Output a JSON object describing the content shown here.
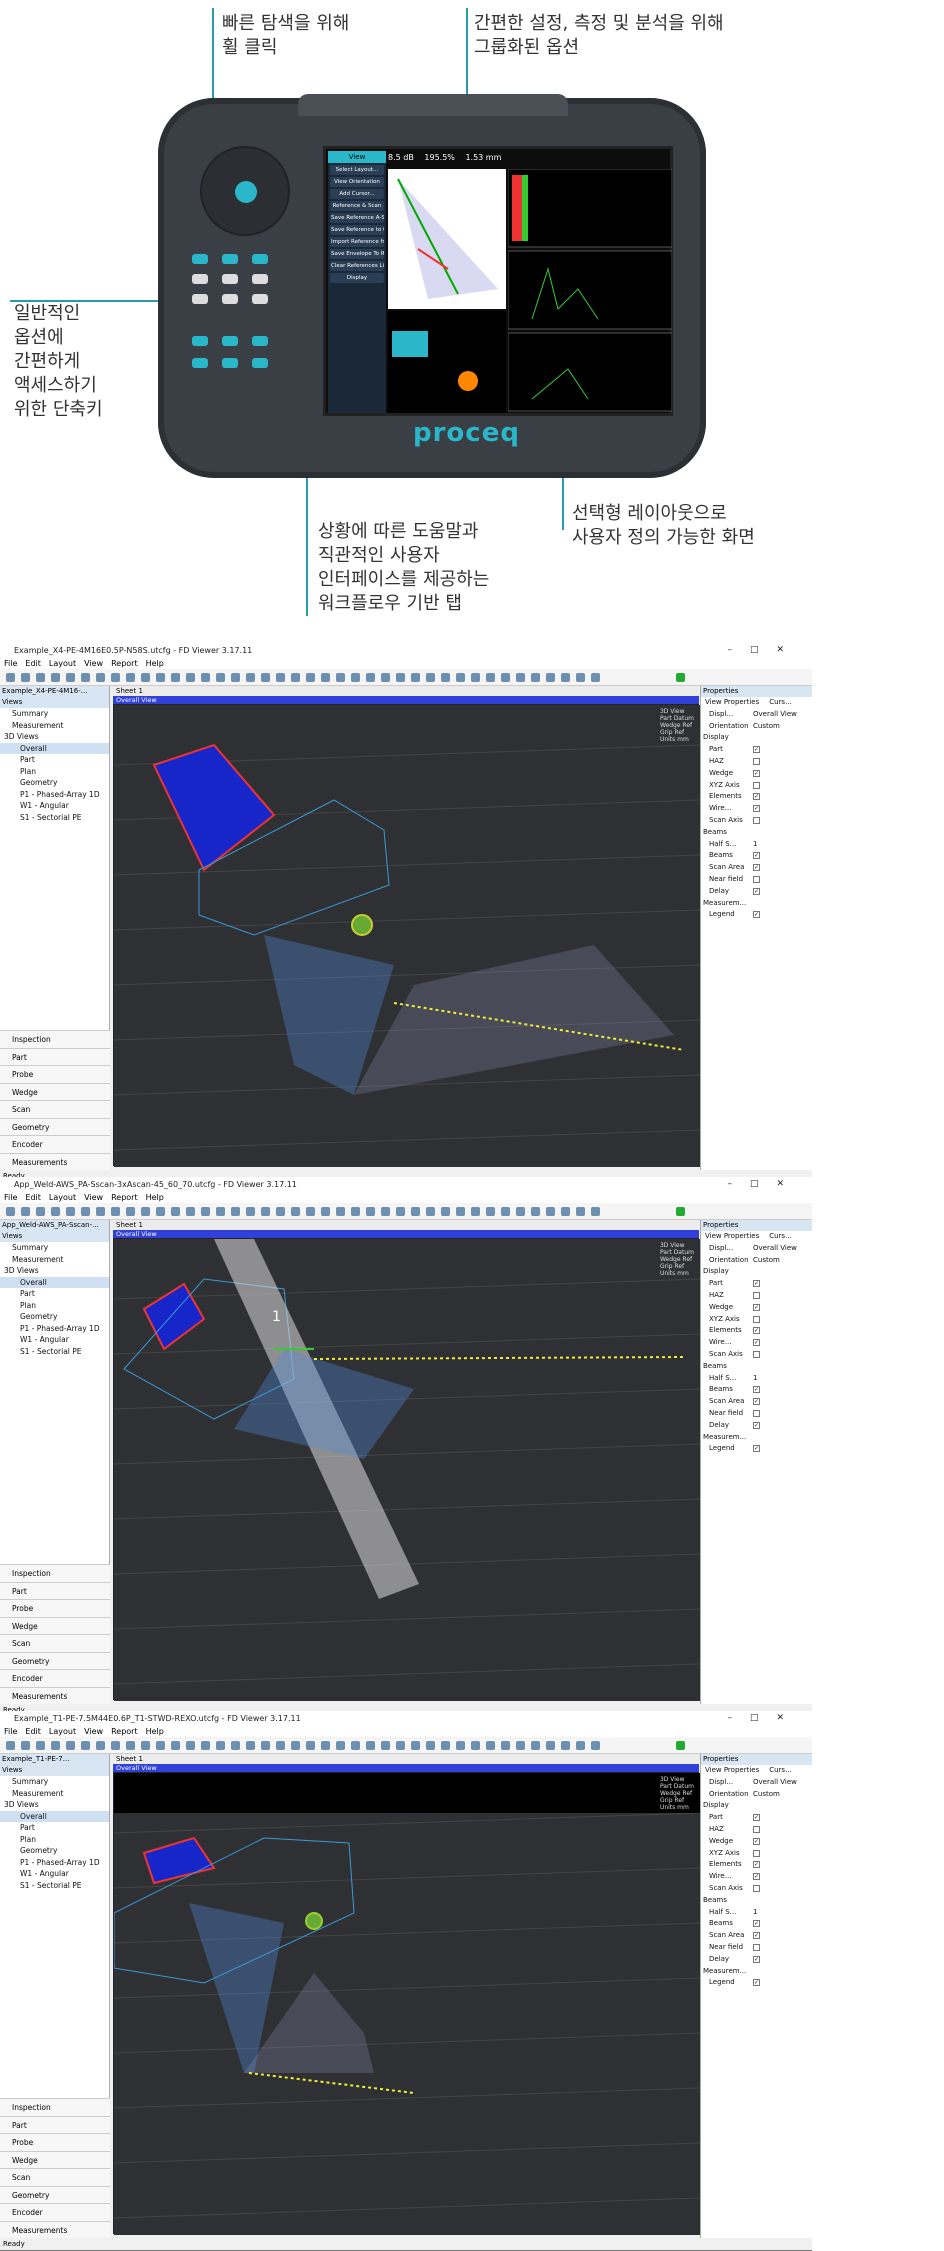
{
  "device": {
    "annotations": {
      "wheel": "빠른 탐색을 위해\n휠 클릭",
      "options": "간편한 설정, 측정 및 분석을 위해\n그룹화된 옵션",
      "shortcut": "일반적인\n옵션에\n간편하게\n액세스하기\n위한 단축키",
      "workflow": "상황에 따른 도움말과\n직관적인 사용자\n인터페이스를 제공하는\n워크플로우 기반 탭",
      "layout": "선택형 레이아웃으로\n사용자 정의 가능한 화면"
    },
    "logo": "proceq",
    "screen": {
      "tab": "View",
      "menu": [
        "Select Layout...",
        "View Orientation",
        "Add Cursor...",
        "Reference & Scan",
        "Save Reference A-Scan",
        "Save Reference to CSV file",
        "Import Reference from CSV file",
        "Save Envelope To References List",
        "Clear References List",
        "Display"
      ],
      "readouts": [
        "8.5 dB",
        "195.5%",
        "1.53 mm"
      ]
    }
  },
  "windows": [
    {
      "title": "Example_X4-PE-4M16E0.5P-N58S.utcfg - FD Viewer 3.17.11",
      "tree_header": "Example_X4-PE-4M16-...",
      "sheet": "Sheet 1"
    },
    {
      "title": "App_Weld-AWS_PA-Sscan-3xAscan-45_60_70.utcfg - FD Viewer 3.17.11",
      "tree_header": "App_Weld-AWS_PA-Sscan-...",
      "sheet": "Sheet 1",
      "marker": "1"
    },
    {
      "title": "Example_T1-PE-7.5M44E0.6P_T1-STWD-REXO.utcfg - FD Viewer 3.17.11",
      "tree_header": "Example_T1-PE-7...",
      "sheet": "Sheet 1"
    }
  ],
  "common": {
    "menu": [
      "File",
      "Edit",
      "Layout",
      "View",
      "Report",
      "Help"
    ],
    "views_label": "Views",
    "tree": [
      "Summary",
      "Measurement",
      "3D Views",
      "Overall",
      "Part",
      "Plan",
      "Geometry",
      "P1 - Phased-Array 1D",
      "W1 - Angular",
      "S1 - Sectorial PE"
    ],
    "accordion": [
      "Inspection",
      "Part",
      "Probe",
      "Wedge",
      "Scan",
      "Geometry",
      "Encoder",
      "Measurements"
    ],
    "view_title": "Overall View",
    "legend": [
      "3D View",
      "Part Datum",
      "Wedge Ref",
      "Grip Ref",
      "Units mm"
    ],
    "properties": {
      "header": "Properties",
      "tabs": [
        "View Properties",
        "Curs..."
      ],
      "disp_tab": "Displ...",
      "overall": "Overall View",
      "orientation_label": "Orientation",
      "orientation": "Custom",
      "display_label": "Display",
      "display_items": [
        "Part",
        "HAZ",
        "Wedge",
        "XYZ Axis",
        "Elements",
        "Wire...",
        "Scan Axis"
      ],
      "display_checked": [
        true,
        false,
        true,
        false,
        true,
        true,
        false
      ],
      "beams_label": "Beams",
      "half_label": "Half S...",
      "half_value": "1",
      "beam_items": [
        "Beams",
        "Scan Area",
        "Near field",
        "Delay"
      ],
      "beam_checked": [
        true,
        true,
        false,
        true
      ],
      "meas_label": "Measurem...",
      "legend_label": "Legend"
    },
    "status": "Ready"
  }
}
